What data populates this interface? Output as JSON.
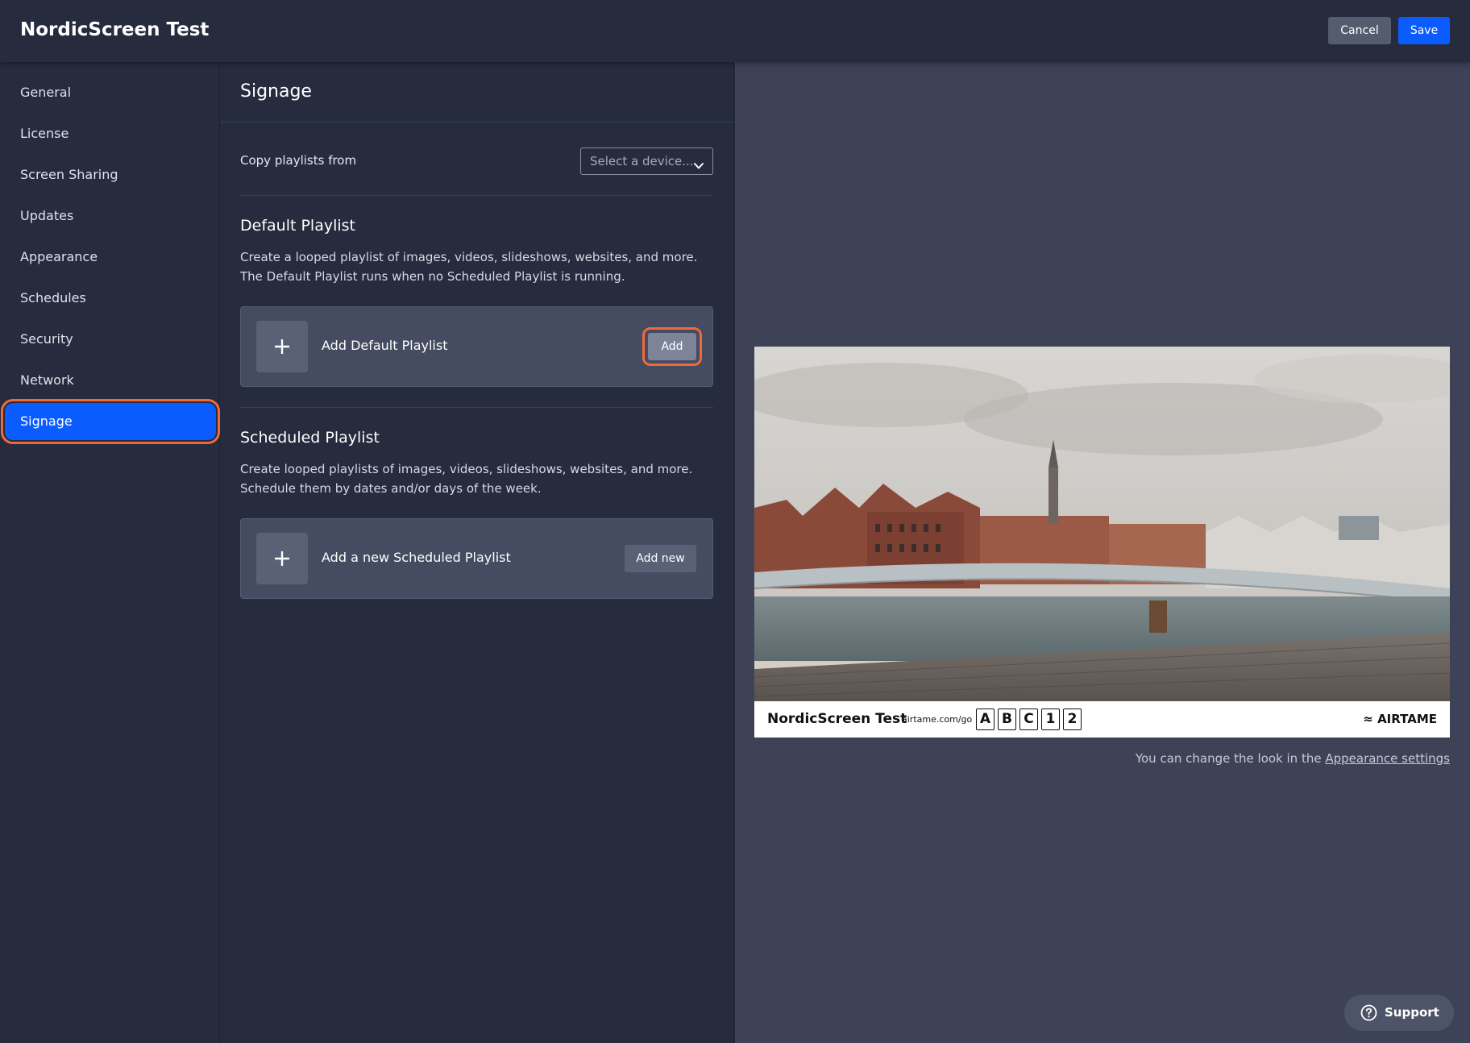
{
  "header": {
    "title": "NordicScreen Test",
    "cancel_label": "Cancel",
    "save_label": "Save"
  },
  "sidebar": {
    "items": [
      {
        "label": "General"
      },
      {
        "label": "License"
      },
      {
        "label": "Screen Sharing"
      },
      {
        "label": "Updates"
      },
      {
        "label": "Appearance"
      },
      {
        "label": "Schedules"
      },
      {
        "label": "Security"
      },
      {
        "label": "Network"
      },
      {
        "label": "Signage",
        "active": true
      }
    ]
  },
  "signage": {
    "title": "Signage",
    "copy_label": "Copy playlists from",
    "select_placeholder": "Select a device...",
    "default_playlist": {
      "title": "Default Playlist",
      "description": "Create a looped playlist of images, videos, slideshows, websites, and more. The Default Playlist runs when no Scheduled Playlist is running.",
      "card_label": "Add Default Playlist",
      "button_label": "Add"
    },
    "scheduled_playlist": {
      "title": "Scheduled Playlist",
      "description": "Create looped playlists of images, videos, slideshows, websites, and more. Schedule them by dates and/or days of the week.",
      "card_label": "Add a new Scheduled Playlist",
      "button_label": "Add new"
    }
  },
  "preview": {
    "device_name": "NordicScreen Test",
    "url": "airtame.com/go",
    "code": [
      "A",
      "B",
      "C",
      "1",
      "2"
    ],
    "brand": "≈ AIRTAME",
    "hint_text": "You can change the look in the",
    "hint_link": "Appearance settings"
  },
  "support": {
    "label": "Support"
  },
  "colors": {
    "accent": "#0a5cff",
    "highlight": "#ee6a3a",
    "background": "#262b3d",
    "preview_bg": "#3d4257"
  }
}
